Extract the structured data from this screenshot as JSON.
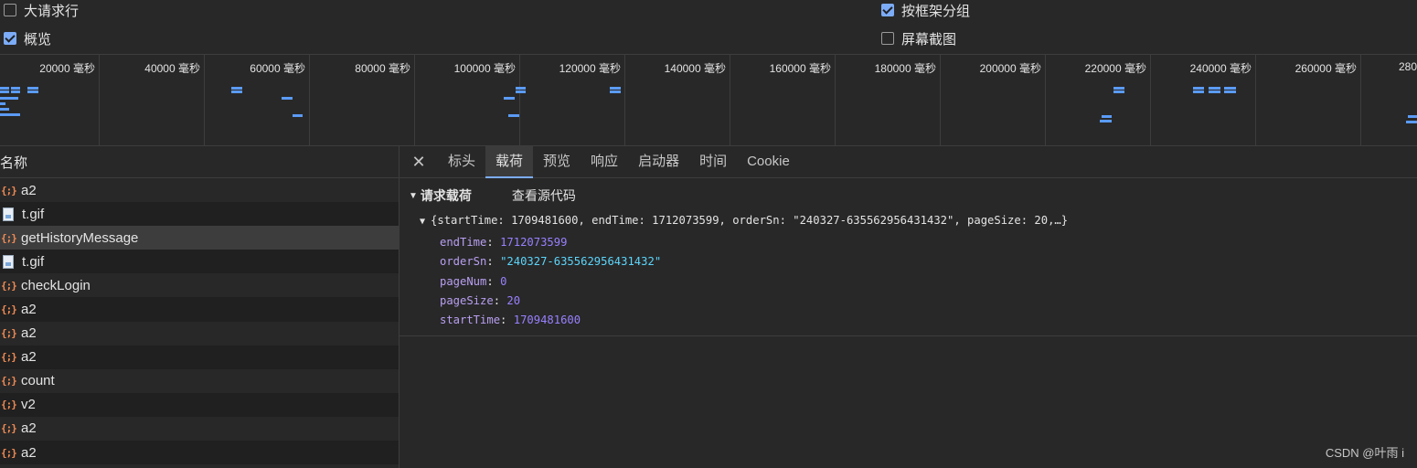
{
  "options": {
    "large_rows": {
      "label": "大请求行",
      "checked": false
    },
    "overview": {
      "label": "概览",
      "checked": true
    },
    "group_by_frame": {
      "label": "按框架分组",
      "checked": true
    },
    "screenshots": {
      "label": "屏幕截图",
      "checked": false
    }
  },
  "timeline": {
    "ticks": [
      "20000 毫秒",
      "40000 毫秒",
      "60000 毫秒",
      "80000 毫秒",
      "100000 毫秒",
      "120000 毫秒",
      "140000 毫秒",
      "160000 毫秒",
      "180000 毫秒",
      "200000 毫秒",
      "220000 毫秒",
      "240000 毫秒",
      "260000 毫秒",
      "280"
    ],
    "bar_color": "#5b9bf6"
  },
  "requests": {
    "column_header": "名称",
    "rows": [
      {
        "name": "a2",
        "type": "json"
      },
      {
        "name": "t.gif",
        "type": "gif"
      },
      {
        "name": "getHistoryMessage",
        "type": "json",
        "selected": true
      },
      {
        "name": "t.gif",
        "type": "gif"
      },
      {
        "name": "checkLogin",
        "type": "json"
      },
      {
        "name": "a2",
        "type": "json"
      },
      {
        "name": "a2",
        "type": "json"
      },
      {
        "name": "a2",
        "type": "json"
      },
      {
        "name": "count",
        "type": "json"
      },
      {
        "name": "v2",
        "type": "json"
      },
      {
        "name": "a2",
        "type": "json"
      },
      {
        "name": "a2",
        "type": "json"
      }
    ]
  },
  "details": {
    "tabs": [
      "标头",
      "载荷",
      "预览",
      "响应",
      "启动器",
      "时间",
      "Cookie"
    ],
    "active_tab": "载荷",
    "payload_title": "请求载荷",
    "view_source": "查看源代码",
    "summary": "{startTime: 1709481600, endTime: 1712073599, orderSn: \"240327-635562956431432\", pageSize: 20,…}",
    "properties": [
      {
        "key": "endTime",
        "value": "1712073599",
        "kind": "number"
      },
      {
        "key": "orderSn",
        "value": "\"240327-635562956431432\"",
        "kind": "string"
      },
      {
        "key": "pageNum",
        "value": "0",
        "kind": "number"
      },
      {
        "key": "pageSize",
        "value": "20",
        "kind": "number"
      },
      {
        "key": "startTime",
        "value": "1709481600",
        "kind": "number"
      }
    ]
  },
  "watermark": "CSDN @叶雨 i",
  "colors": {
    "accent": "#7cacf8",
    "json_icon": "#f28b54",
    "string": "#5cd5fb",
    "number": "#9980ff",
    "key": "#b89ff1"
  }
}
